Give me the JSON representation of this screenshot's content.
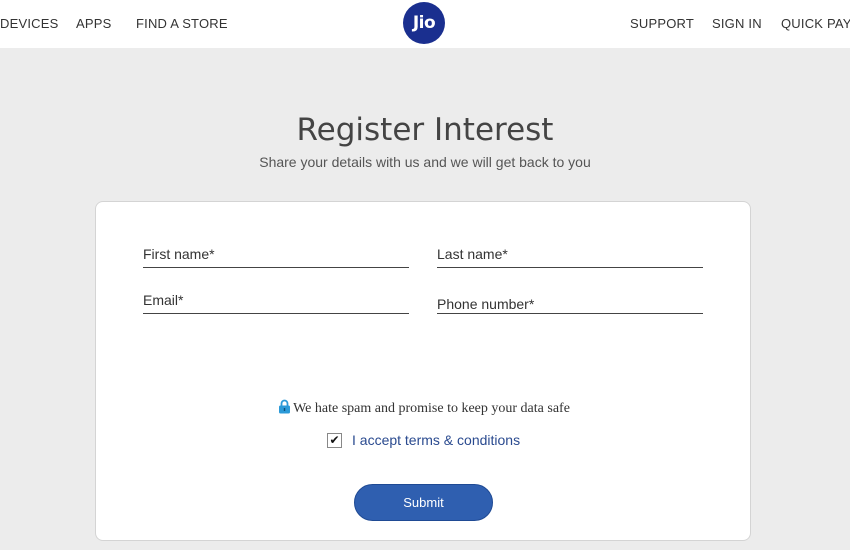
{
  "nav": {
    "devices": "DEVICES",
    "apps": "APPS",
    "find_store": "FIND A STORE",
    "support": "SUPPORT",
    "sign_in": "SIGN IN",
    "quick_pay": "QUICK PAY"
  },
  "logo": {
    "text": "Jio",
    "color": "#1a2f8f"
  },
  "page": {
    "title": "Register Interest",
    "subtitle": "Share your details with us and we will get back to you"
  },
  "form": {
    "first_name": {
      "placeholder": "First name*",
      "value": ""
    },
    "last_name": {
      "placeholder": "Last name*",
      "value": ""
    },
    "email": {
      "placeholder": "Email*",
      "value": ""
    },
    "phone": {
      "placeholder": "Phone number*",
      "value": ""
    },
    "notice": "We hate spam and promise to keep your data safe",
    "accept_label": "I accept terms & conditions",
    "accept_checked": true,
    "submit_label": "Submit"
  },
  "colors": {
    "background": "#ececec",
    "accent": "#2f5fb0",
    "link": "#2a4a8f"
  }
}
